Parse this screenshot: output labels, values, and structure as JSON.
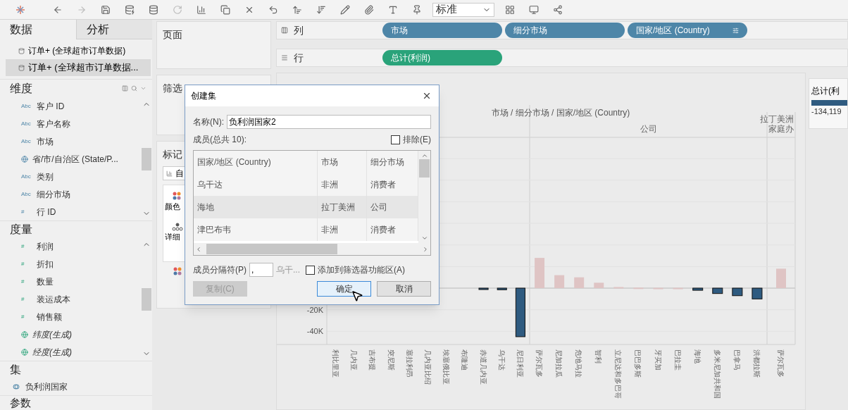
{
  "toolbar": {
    "view_select": "标准"
  },
  "side_tabs": [
    {
      "label": "数据",
      "selected": true
    },
    {
      "label": "分析",
      "selected": false
    }
  ],
  "data_sources": [
    {
      "label": "订单+ (全球超市订单数据)",
      "selected": false
    },
    {
      "label": "订单+ (全球超市订单数据...",
      "selected": true
    }
  ],
  "dimensions": {
    "title": "维度",
    "items": [
      {
        "kind": "text",
        "badge": "Abc",
        "label": "客户 ID"
      },
      {
        "kind": "text",
        "badge": "Abc",
        "label": "客户名称"
      },
      {
        "kind": "text",
        "badge": "Abc",
        "label": "市场"
      },
      {
        "kind": "geo",
        "label": "省/市/自治区 (State/P..."
      },
      {
        "kind": "text",
        "badge": "Abc",
        "label": "类别"
      },
      {
        "kind": "text",
        "badge": "Abc",
        "label": "细分市场"
      },
      {
        "kind": "number",
        "badge": "#",
        "label": "行 ID"
      }
    ]
  },
  "measures": {
    "title": "度量",
    "items": [
      {
        "kind": "number",
        "badge": "#",
        "label": "利润",
        "generated": false
      },
      {
        "kind": "number",
        "badge": "#",
        "label": "折扣",
        "generated": false
      },
      {
        "kind": "number",
        "badge": "#",
        "label": "数量",
        "generated": false
      },
      {
        "kind": "number",
        "badge": "#",
        "label": "装运成本",
        "generated": false
      },
      {
        "kind": "number",
        "badge": "#",
        "label": "销售额",
        "generated": false
      },
      {
        "kind": "geo",
        "label": "纬度(生成)",
        "generated": true
      },
      {
        "kind": "geo",
        "label": "经度(生成)",
        "generated": true
      }
    ]
  },
  "sets": {
    "title": "集",
    "items": [
      {
        "label": "负利润国家"
      }
    ]
  },
  "parameters": {
    "title": "参数"
  },
  "cards": {
    "pages": "页面",
    "filters": "筛选",
    "marks": {
      "title": "标记",
      "type": "自",
      "color_label": "颜色",
      "detail": "详细"
    }
  },
  "shelves": [
    {
      "label": "列",
      "kind": "columns",
      "pills": [
        {
          "label": "市场",
          "color": "#4e86a8",
          "sorted": false
        },
        {
          "label": "细分市场",
          "color": "#4e86a8",
          "sorted": false
        },
        {
          "label": "国家/地区 (Country)",
          "color": "#4e86a8",
          "sorted": true
        }
      ]
    },
    {
      "label": "行",
      "kind": "rows",
      "pills": [
        {
          "label": "总计(利润)",
          "color": "#2aa37a",
          "sorted": false
        }
      ]
    }
  ],
  "chart": {
    "title": "市场 / 细分市场 / 国家/地区 (Country)",
    "section_headers": [
      {
        "lines": [
          "公司"
        ]
      },
      {
        "lines": [
          "拉丁美洲",
          "家庭办"
        ]
      }
    ],
    "chart_data": {
      "type": "bar",
      "stacked": true,
      "ylim": [
        -52,
        139
      ],
      "yticks": [
        {
          "value": -20,
          "label": "-20K"
        },
        {
          "value": -40,
          "label": "-40K"
        }
      ],
      "categories": [
        "利比里亚",
        "几内亚",
        "吉布提",
        "突尼斯",
        "塞拉利昂",
        "几内亚比绍",
        "埃塞俄比亚",
        "布隆迪",
        "赤道几内亚",
        "乌干达",
        "尼日利亚",
        "萨尔瓦多",
        "尼加拉瓜",
        "危地马拉",
        "智利",
        "立尼达和多巴哥",
        "巴巴多斯",
        "牙买加",
        "巴拉圭",
        "海地",
        "多米尼加共和国",
        "巴拿马",
        "洪都拉斯",
        "萨尔瓦多"
      ],
      "series": [
        {
          "color": "#2f5b80",
          "values": [
            null,
            null,
            null,
            null,
            null,
            null,
            null,
            null,
            -1,
            -1.5,
            -45,
            null,
            null,
            null,
            null,
            null,
            null,
            null,
            null,
            -2,
            -5,
            -7,
            -10,
            null
          ]
        },
        {
          "color": "#dfc4c4",
          "values": [
            null,
            null,
            null,
            null,
            null,
            null,
            null,
            null,
            null,
            null,
            null,
            28,
            12,
            10,
            5,
            1,
            0.5,
            0.3,
            0.3,
            null,
            null,
            null,
            null,
            18
          ]
        }
      ]
    }
  },
  "legend": {
    "title": "总计(利",
    "value": "-134,119"
  },
  "dialog": {
    "title": "创建集",
    "name_label": "名称(N):",
    "name_value": "负利润国家2",
    "members_label": "成员(总共 10):",
    "exclude": {
      "label": "排除(E)",
      "checked": false
    },
    "columns": [
      "国家/地区 (Country)",
      "市场",
      "细分市场"
    ],
    "rows": [
      {
        "cells": [
          "乌干达",
          "非洲",
          "消费者"
        ],
        "selected": false
      },
      {
        "cells": [
          "海地",
          "拉丁美洲",
          "公司"
        ],
        "selected": true
      },
      {
        "cells": [
          "津巴布韦",
          "非洲",
          "消费者"
        ],
        "selected": false
      }
    ],
    "separator_label": "成员分隔符(P)",
    "separator_value": ",",
    "preview": "乌干...",
    "add_filter": {
      "label": "添加到筛选器功能区(A)",
      "checked": false
    },
    "buttons": [
      {
        "label": "复制(C)",
        "disabled": true,
        "default": false
      },
      {
        "label": "确定",
        "disabled": false,
        "default": true
      },
      {
        "label": "取消",
        "disabled": false,
        "default": false
      }
    ]
  }
}
